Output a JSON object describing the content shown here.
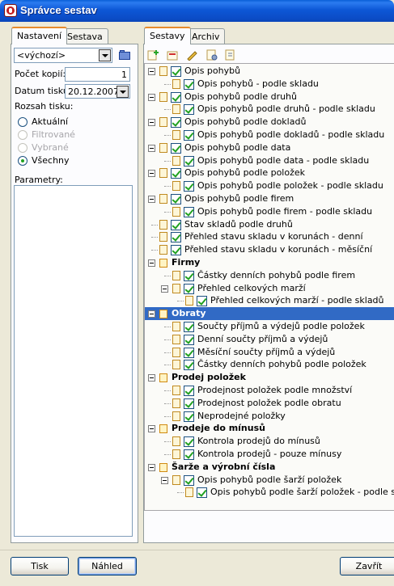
{
  "window": {
    "title": "Správce sestav"
  },
  "left_tabs": [
    {
      "label": "Nastavení",
      "active": true
    },
    {
      "label": "Sestava",
      "active": false
    }
  ],
  "template_combo": {
    "value": "<výchozí>"
  },
  "copies": {
    "label": "Počet kopií:",
    "value": "1"
  },
  "print_date": {
    "label": "Datum tisku:",
    "value": "20.12.2007"
  },
  "print_range": {
    "label": "Rozsah tisku:",
    "options": [
      {
        "label": "Aktuální",
        "enabled": true,
        "checked": false
      },
      {
        "label": "Filtrované",
        "enabled": false,
        "checked": false
      },
      {
        "label": "Vybrané",
        "enabled": false,
        "checked": false
      },
      {
        "label": "Všechny",
        "enabled": true,
        "checked": true
      }
    ]
  },
  "parameters": {
    "label": "Parametry:"
  },
  "right_tabs": [
    {
      "label": "Sestavy",
      "active": true
    },
    {
      "label": "Archiv",
      "active": false
    }
  ],
  "toolbar_icons": [
    "add-report-icon",
    "delete-report-icon",
    "edit-report-icon",
    "report-settings-icon",
    "report-export-icon"
  ],
  "tree": [
    {
      "label": "Opis pohybů",
      "level": 0,
      "kind": "doc-checked",
      "expanded": true
    },
    {
      "label": "Opis pohybů - podle skladu",
      "level": 1,
      "kind": "doc-checked"
    },
    {
      "label": "Opis pohybů podle druhů",
      "level": 0,
      "kind": "doc-checked",
      "expanded": true
    },
    {
      "label": "Opis pohybů podle druhů - podle skladu",
      "level": 1,
      "kind": "doc-checked"
    },
    {
      "label": "Opis pohybů podle dokladů",
      "level": 0,
      "kind": "doc-checked",
      "expanded": true
    },
    {
      "label": "Opis pohybů podle dokladů - podle skladu",
      "level": 1,
      "kind": "doc-checked"
    },
    {
      "label": "Opis pohybů podle data",
      "level": 0,
      "kind": "doc-checked",
      "expanded": true
    },
    {
      "label": "Opis pohybů podle data - podle skladu",
      "level": 1,
      "kind": "doc-checked"
    },
    {
      "label": "Opis pohybů podle položek",
      "level": 0,
      "kind": "doc-checked",
      "expanded": true
    },
    {
      "label": "Opis pohybů podle položek - podle skladu",
      "level": 1,
      "kind": "doc-checked"
    },
    {
      "label": "Opis pohybů podle firem",
      "level": 0,
      "kind": "doc-checked",
      "expanded": true
    },
    {
      "label": "Opis pohybů podle firem - podle skladu",
      "level": 1,
      "kind": "doc-checked"
    },
    {
      "label": "Stav skladů podle druhů",
      "level": 0,
      "kind": "doc-checked"
    },
    {
      "label": "Přehled stavu skladu v korunách - denní",
      "level": 0,
      "kind": "doc-checked"
    },
    {
      "label": "Přehled stavu skladu v korunách - měsíční",
      "level": 0,
      "kind": "doc-checked"
    },
    {
      "label": "Firmy",
      "level": 0,
      "kind": "group",
      "expanded": true
    },
    {
      "label": "Částky denních pohybů podle firem",
      "level": 1,
      "kind": "doc-checked"
    },
    {
      "label": "Přehled celkových marží",
      "level": 1,
      "kind": "doc-checked",
      "expanded": true
    },
    {
      "label": "Přehled celkových marží - podle skladů",
      "level": 2,
      "kind": "doc-checked"
    },
    {
      "label": "Obraty",
      "level": 0,
      "kind": "group",
      "expanded": true,
      "selected": true
    },
    {
      "label": "Součty příjmů a výdejů podle položek",
      "level": 1,
      "kind": "doc-checked"
    },
    {
      "label": "Denní součty příjmů a výdejů",
      "level": 1,
      "kind": "doc-checked"
    },
    {
      "label": "Měsíční součty příjmů a výdejů",
      "level": 1,
      "kind": "doc-checked"
    },
    {
      "label": "Částky denních pohybů podle položek",
      "level": 1,
      "kind": "doc-checked"
    },
    {
      "label": "Prodej položek",
      "level": 0,
      "kind": "group",
      "expanded": true
    },
    {
      "label": "Prodejnost položek podle množství",
      "level": 1,
      "kind": "doc-checked"
    },
    {
      "label": "Prodejnost položek podle obratu",
      "level": 1,
      "kind": "doc-checked"
    },
    {
      "label": "Neprodejné položky",
      "level": 1,
      "kind": "doc-checked"
    },
    {
      "label": "Prodeje do mínusů",
      "level": 0,
      "kind": "group",
      "expanded": true
    },
    {
      "label": "Kontrola prodejů do mínusů",
      "level": 1,
      "kind": "doc-checked"
    },
    {
      "label": "Kontrola prodejů - pouze mínusy",
      "level": 1,
      "kind": "doc-checked"
    },
    {
      "label": "Šarže a výrobní čísla",
      "level": 0,
      "kind": "group",
      "expanded": true
    },
    {
      "label": "Opis pohybů podle šarží položek",
      "level": 1,
      "kind": "doc-checked",
      "expanded": true
    },
    {
      "label": "Opis pohybů podle šarží položek - podle skladu",
      "level": 2,
      "kind": "doc-checked"
    }
  ],
  "buttons": {
    "print": "Tisk",
    "preview": "Náhled",
    "close": "Zavřít"
  }
}
